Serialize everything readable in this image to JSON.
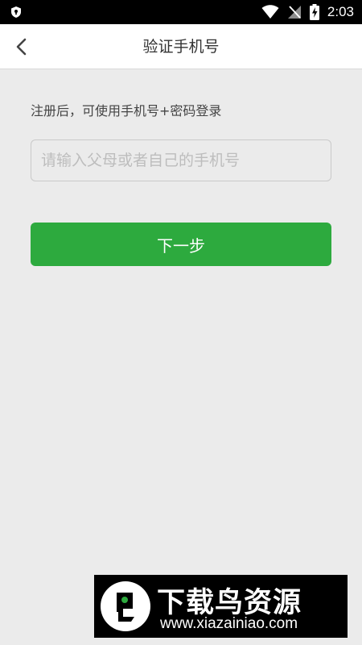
{
  "status_bar": {
    "time": "2:03",
    "icons": [
      "shield-icon",
      "wifi-icon",
      "no-sim-icon",
      "battery-charging-icon"
    ]
  },
  "nav": {
    "title": "验证手机号",
    "back_icon": "chevron-left-icon"
  },
  "form": {
    "hint": "注册后，可使用手机号+密码登录",
    "phone_placeholder": "请输入父母或者自己的手机号",
    "phone_value": "",
    "next_label": "下一步"
  },
  "watermark": {
    "name": "下载鸟资源",
    "url": "www.xiazainiao.com"
  },
  "colors": {
    "primary": "#2daa3e",
    "background": "#ebebeb",
    "nav_background": "#ffffff",
    "status_bar": "#000000"
  }
}
